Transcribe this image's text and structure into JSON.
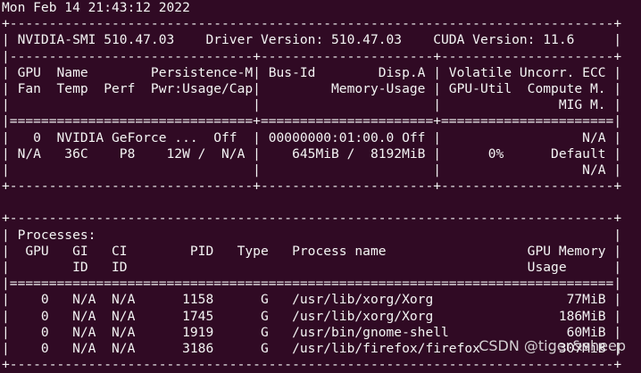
{
  "terminal": {
    "timestamp": "Mon Feb 14 21:43:12 2022",
    "lines": [
      "+-----------------------------------------------------------------------------+",
      "| NVIDIA-SMI 510.47.03    Driver Version: 510.47.03    CUDA Version: 11.6     |",
      "|-------------------------------+----------------------+----------------------+",
      "| GPU  Name        Persistence-M| Bus-Id        Disp.A | Volatile Uncorr. ECC |",
      "| Fan  Temp  Perf  Pwr:Usage/Cap|         Memory-Usage | GPU-Util  Compute M. |",
      "|                               |                      |               MIG M. |",
      "|===============================+======================+======================|",
      "|   0  NVIDIA GeForce ...  Off  | 00000000:01:00.0 Off |                  N/A |",
      "| N/A   36C    P8    12W /  N/A |    645MiB /  8192MiB |      0%      Default |",
      "|                               |                      |                  N/A |",
      "+-------------------------------+----------------------+----------------------+",
      "",
      "+-----------------------------------------------------------------------------+",
      "| Processes:                                                                  |",
      "|  GPU   GI   CI        PID   Type   Process name                  GPU Memory |",
      "|        ID   ID                                                   Usage      |",
      "|=============================================================================|",
      "|    0   N/A  N/A      1158      G   /usr/lib/xorg/Xorg                 77MiB |",
      "|    0   N/A  N/A      1745      G   /usr/lib/xorg/Xorg                186MiB |",
      "|    0   N/A  N/A      1919      G   /usr/bin/gnome-shell               60MiB |",
      "|    0   N/A  N/A      3186      G   /usr/lib/firefox/firefox          307MiB |",
      "+-----------------------------------------------------------------------------+"
    ]
  },
  "watermark": "CSDN @tiger&sheep",
  "colors": {
    "background": "#300a24",
    "text": "#f4f4f4"
  }
}
